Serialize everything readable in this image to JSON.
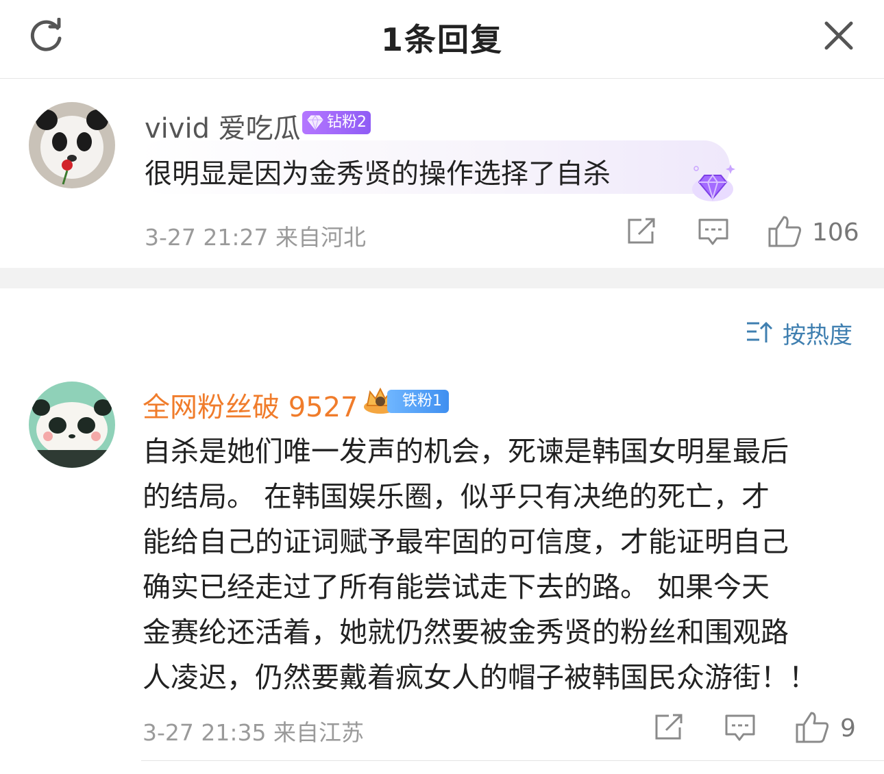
{
  "header": {
    "title": "1条回复",
    "refresh_icon": "refresh-icon",
    "close_icon": "close-icon"
  },
  "root_comment": {
    "username": "vivid 爱吃瓜",
    "badge": "钻粉2",
    "text": "很明显是因为金秀贤的操作选择了自杀",
    "meta": "3-27 21:27  来自河北",
    "likes": "106"
  },
  "sort": {
    "label": "按热度"
  },
  "reply": {
    "username": "全网粉丝破 9527",
    "badge": "铁粉1",
    "lines": [
      "自杀是她们唯一发声的机会，死谏是韩国女明星最后",
      "的结局。   在韩国娱乐圈，似乎只有决绝的死亡，才",
      "能给自己的证词赋予最牢固的可信度，才能证明自己",
      "确实已经走过了所有能尝试走下去的路。   如果今天",
      "金赛纶还活着，她就仍然要被金秀贤的粉丝和围观路",
      "人凌迟，仍然要戴着疯女人的帽子被韩国民众游街！！"
    ],
    "meta": "3-27 21:35  来自江苏",
    "likes": "9"
  },
  "colors": {
    "reply_username": "#f07c2b",
    "sort_accent": "#3f7fb0",
    "diamond_badge": "#9b63f7",
    "iron_badge": "#4a97f2"
  }
}
